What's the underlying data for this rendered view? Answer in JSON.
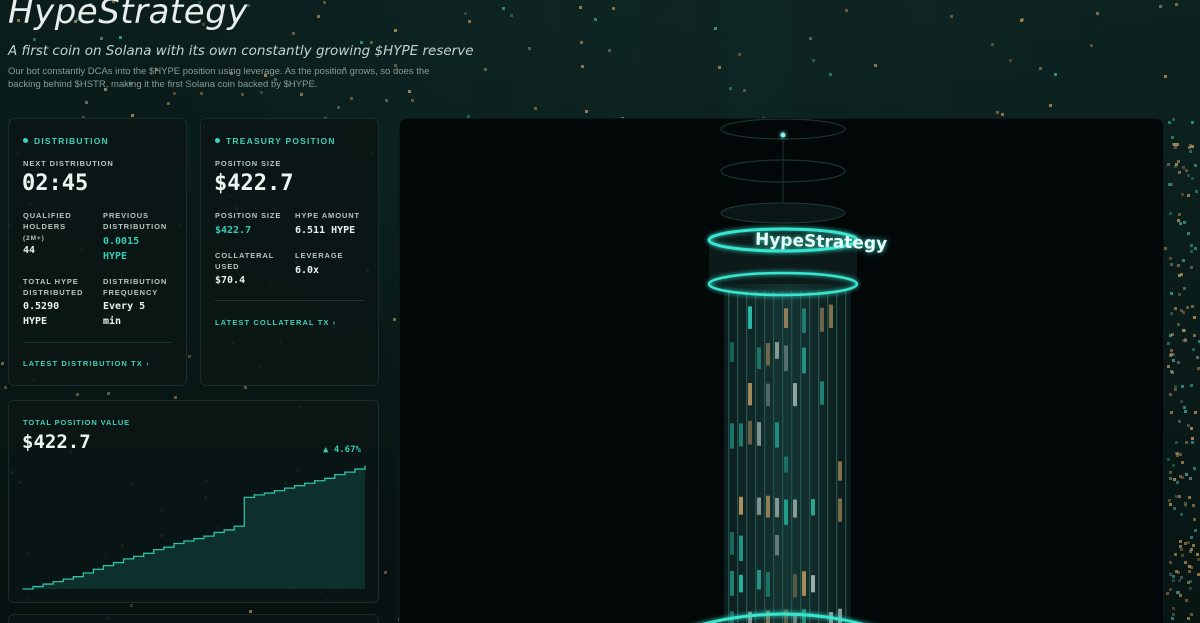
{
  "hero": {
    "title": "HypeStrategy",
    "tagline": "A first coin on Solana with its own constantly growing $HYPE reserve",
    "description": "Our bot constantly DCAs into the $HYPE position using leverage. As the position grows, so does the backing behind $HSTR, making it the first Solana coin backed by $HYPE."
  },
  "distribution": {
    "title": "DISTRIBUTION",
    "next_label": "NEXT DISTRIBUTION",
    "next_value": "02:45",
    "qualified_label_1": "QUALIFIED",
    "qualified_label_2": "HOLDERS",
    "qualified_label_3": "(2M+)",
    "qualified_value": "44",
    "previous_label_1": "PREVIOUS",
    "previous_label_2": "DISTRIBUTION",
    "previous_value_1": "0.0015",
    "previous_value_2": "HYPE",
    "total_label_1": "TOTAL HYPE",
    "total_label_2": "DISTRIBUTED",
    "total_value_1": "0.5290",
    "total_value_2": "HYPE",
    "frequency_label_1": "DISTRIBUTION",
    "frequency_label_2": "FREQUENCY",
    "frequency_value_1": "Every 5",
    "frequency_value_2": "min",
    "link": "LATEST DISTRIBUTION TX  ›"
  },
  "treasury": {
    "title": "TREASURY POSITION",
    "size_label": "POSITION SIZE",
    "size_value": "$422.7",
    "size2_label": "POSITION SIZE",
    "size2_value": "$422.7",
    "hype_label": "HYPE AMOUNT",
    "hype_value": "6.511 HYPE",
    "collateral_label_1": "COLLATERAL",
    "collateral_label_2": "USED",
    "collateral_value": "$70.4",
    "leverage_label": "LEVERAGE",
    "leverage_value": "6.0x",
    "link": "LATEST COLLATERAL TX  ›"
  },
  "position_chart": {
    "title": "TOTAL POSITION VALUE",
    "value": "$422.7",
    "change": "▲ 4.67%",
    "line_color": "#2fbfa7",
    "fill_color": "#0f3a34"
  },
  "scene": {
    "sign_text": "HypeStrategy",
    "glow_color": "#38e6cf"
  },
  "colors": {
    "accent": "#3fd0b8",
    "background": "#071513"
  },
  "chart_data": {
    "type": "area",
    "title": "TOTAL POSITION VALUE",
    "x": [
      0,
      1,
      2,
      3,
      4,
      5,
      6,
      7,
      8,
      9,
      10,
      11,
      12,
      13,
      14,
      15,
      16,
      17,
      18,
      19,
      20,
      21,
      22,
      23,
      24,
      25,
      26,
      27,
      28,
      29,
      30,
      31,
      32,
      33,
      34
    ],
    "values": [
      0.0,
      0.4,
      0.8,
      1.2,
      1.6,
      2.0,
      2.6,
      3.2,
      3.8,
      4.3,
      4.9,
      5.3,
      5.8,
      6.4,
      6.8,
      7.4,
      7.8,
      8.2,
      8.6,
      9.2,
      9.6,
      10.2,
      14.9,
      15.3,
      15.6,
      16.0,
      16.4,
      16.8,
      17.2,
      17.6,
      18.0,
      18.6,
      19.0,
      19.5,
      20.0
    ],
    "xlabel": "",
    "ylabel": "",
    "grid": false
  }
}
